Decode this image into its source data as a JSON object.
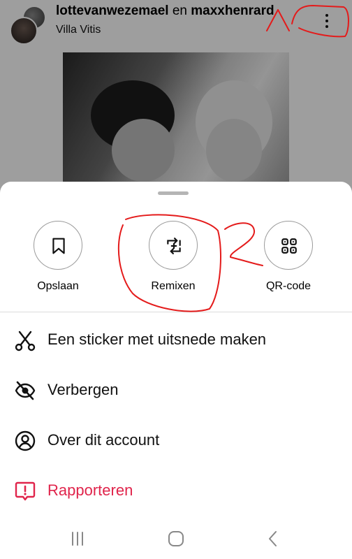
{
  "post": {
    "user1": "lottevanwezemael",
    "connector": " en ",
    "user2": "maxxhenrard",
    "location": "Villa Vitis"
  },
  "quick_actions": [
    {
      "label": "Opslaan",
      "icon": "bookmark-icon"
    },
    {
      "label": "Remixen",
      "icon": "remix-icon"
    },
    {
      "label": "QR-code",
      "icon": "qr-code-icon"
    }
  ],
  "menu": [
    {
      "label": "Een sticker met uitsnede maken",
      "icon": "scissors-icon"
    },
    {
      "label": "Verbergen",
      "icon": "eye-off-icon"
    },
    {
      "label": "Over dit account",
      "icon": "account-icon"
    },
    {
      "label": "Rapporteren",
      "icon": "report-icon"
    }
  ],
  "annotation_label": "2",
  "colors": {
    "danger": "#e0244b",
    "annotation": "#e41b1b",
    "overlay": "rgba(0,0,0,0.38)"
  }
}
